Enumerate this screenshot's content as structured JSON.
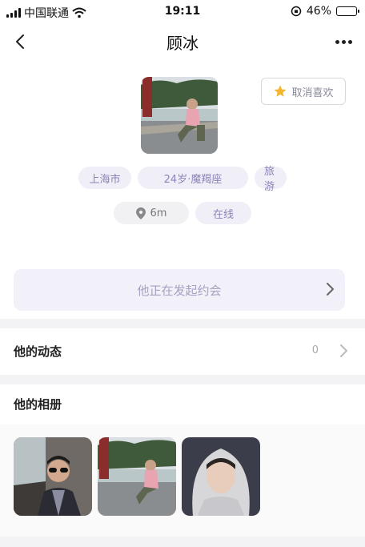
{
  "status_bar": {
    "carrier": "中国联通",
    "time": "19:11",
    "battery": "46%",
    "battery_level": 0.46
  },
  "nav": {
    "title": "顾冰"
  },
  "profile": {
    "unlike_label": "取消喜欢",
    "tags_row1": [
      "上海市",
      "24岁·魔羯座",
      "旅游"
    ],
    "distance": "6m",
    "online": "在线"
  },
  "dating_banner": {
    "text": "他正在发起约会"
  },
  "feed": {
    "label": "他的动态",
    "count": "0"
  },
  "album": {
    "title": "他的相册"
  },
  "colors": {
    "accent_tag_bg": "#f0eff8",
    "accent_tag_text": "#8b84b8",
    "star": "#f3b62f"
  }
}
